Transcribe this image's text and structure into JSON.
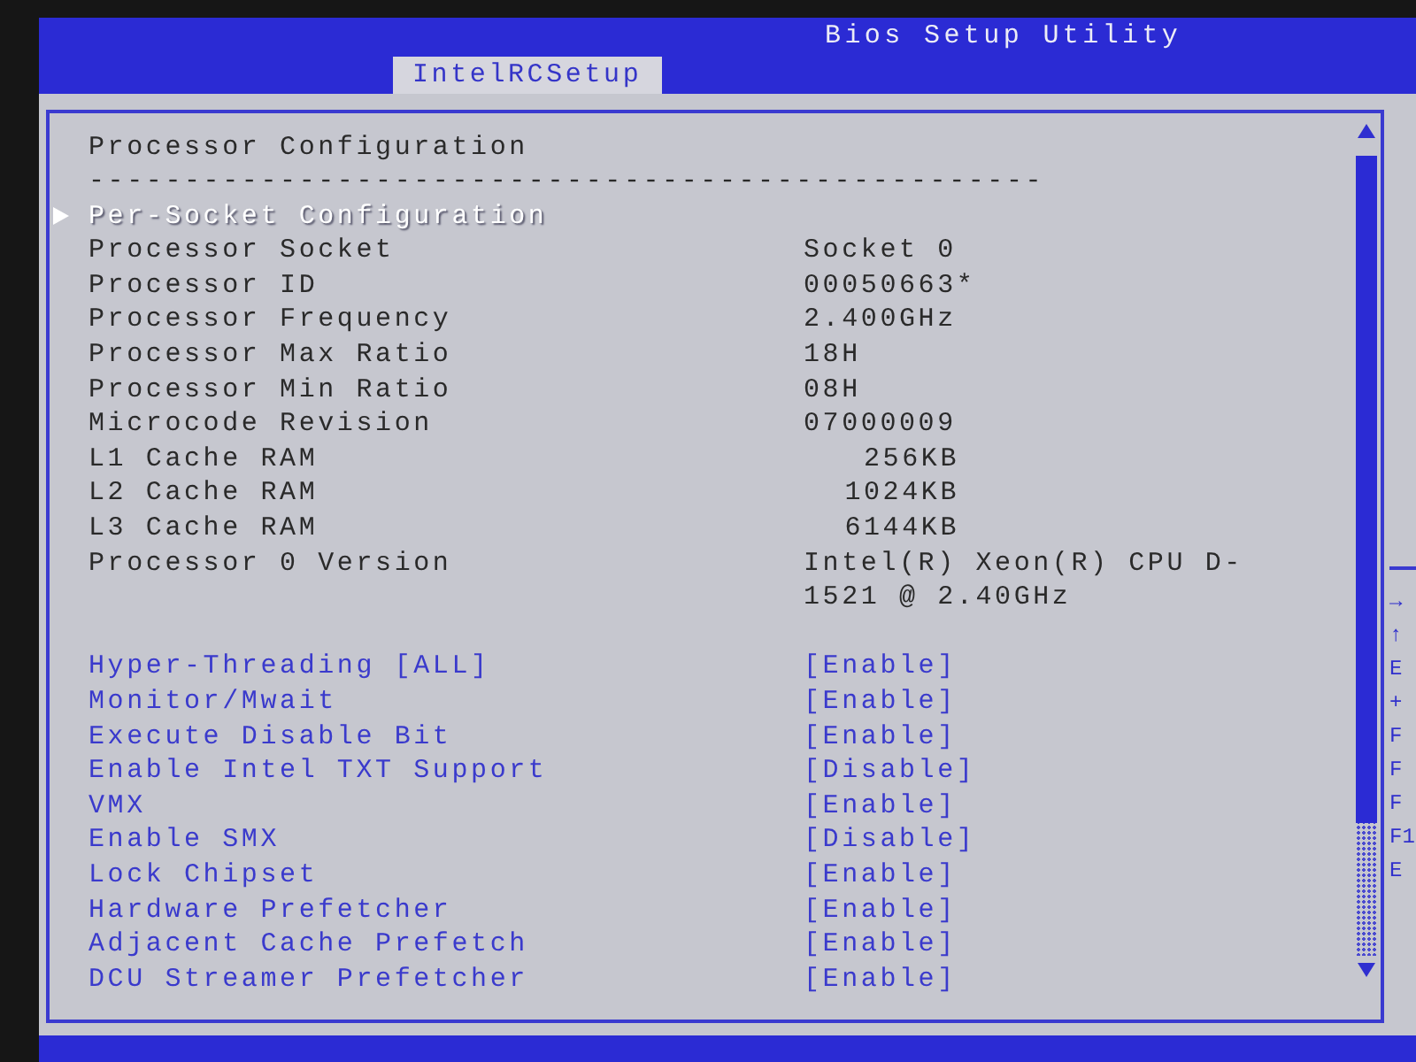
{
  "header": {
    "title": "Bios Setup Utility",
    "tabs": [
      {
        "label": "IntelRCSetup",
        "selected": true
      }
    ]
  },
  "page": {
    "title": "Processor Configuration",
    "divider": "--------------------------------------------------",
    "submenus": [
      {
        "label": "Per-Socket Configuration",
        "selected": true
      }
    ],
    "info_rows": [
      {
        "kind": "text",
        "label": "Processor Socket",
        "value": "Socket 0"
      },
      {
        "kind": "text",
        "label": "Processor ID",
        "value": "00050663*"
      },
      {
        "kind": "text",
        "label": "Processor Frequency",
        "value": "2.400GHz"
      },
      {
        "kind": "text",
        "label": "Processor Max Ratio",
        "value": "18H"
      },
      {
        "kind": "text",
        "label": "Processor Min Ratio",
        "value": "08H"
      },
      {
        "kind": "text",
        "label": "Microcode Revision",
        "value": "07000009"
      },
      {
        "kind": "size",
        "label": "L1 Cache RAM",
        "value": "256KB"
      },
      {
        "kind": "size",
        "label": "L2 Cache RAM",
        "value": "1024KB"
      },
      {
        "kind": "size",
        "label": "L3 Cache RAM",
        "value": "6144KB"
      },
      {
        "kind": "text",
        "label": "Processor 0 Version",
        "value": "Intel(R) Xeon(R) CPU D-1521 @ 2.40GHz"
      }
    ],
    "settings": [
      {
        "label": "Hyper-Threading [ALL]",
        "value": "[Enable]",
        "selected": false
      },
      {
        "label": "Monitor/Mwait",
        "value": "[Enable]",
        "selected": false
      },
      {
        "label": "Execute Disable Bit",
        "value": "[Enable]",
        "selected": false
      },
      {
        "label": "Enable Intel TXT Support",
        "value": "[Disable]",
        "selected": false
      },
      {
        "label": "VMX",
        "value": "[Enable]",
        "selected": false
      },
      {
        "label": "Enable SMX",
        "value": "[Disable]",
        "selected": false
      },
      {
        "label": "Lock Chipset",
        "value": "[Enable]",
        "selected": false
      },
      {
        "label": "Hardware Prefetcher",
        "value": "[Enable]",
        "selected": false
      },
      {
        "label": "Adjacent Cache Prefetch",
        "value": "[Enable]",
        "selected": false
      },
      {
        "label": "DCU Streamer Prefetcher",
        "value": "[Enable]",
        "selected": false
      }
    ]
  },
  "help_panel": {
    "keys": [
      "→",
      "↑",
      "E",
      "+",
      "F",
      "F",
      "F",
      "F1",
      "E"
    ]
  }
}
